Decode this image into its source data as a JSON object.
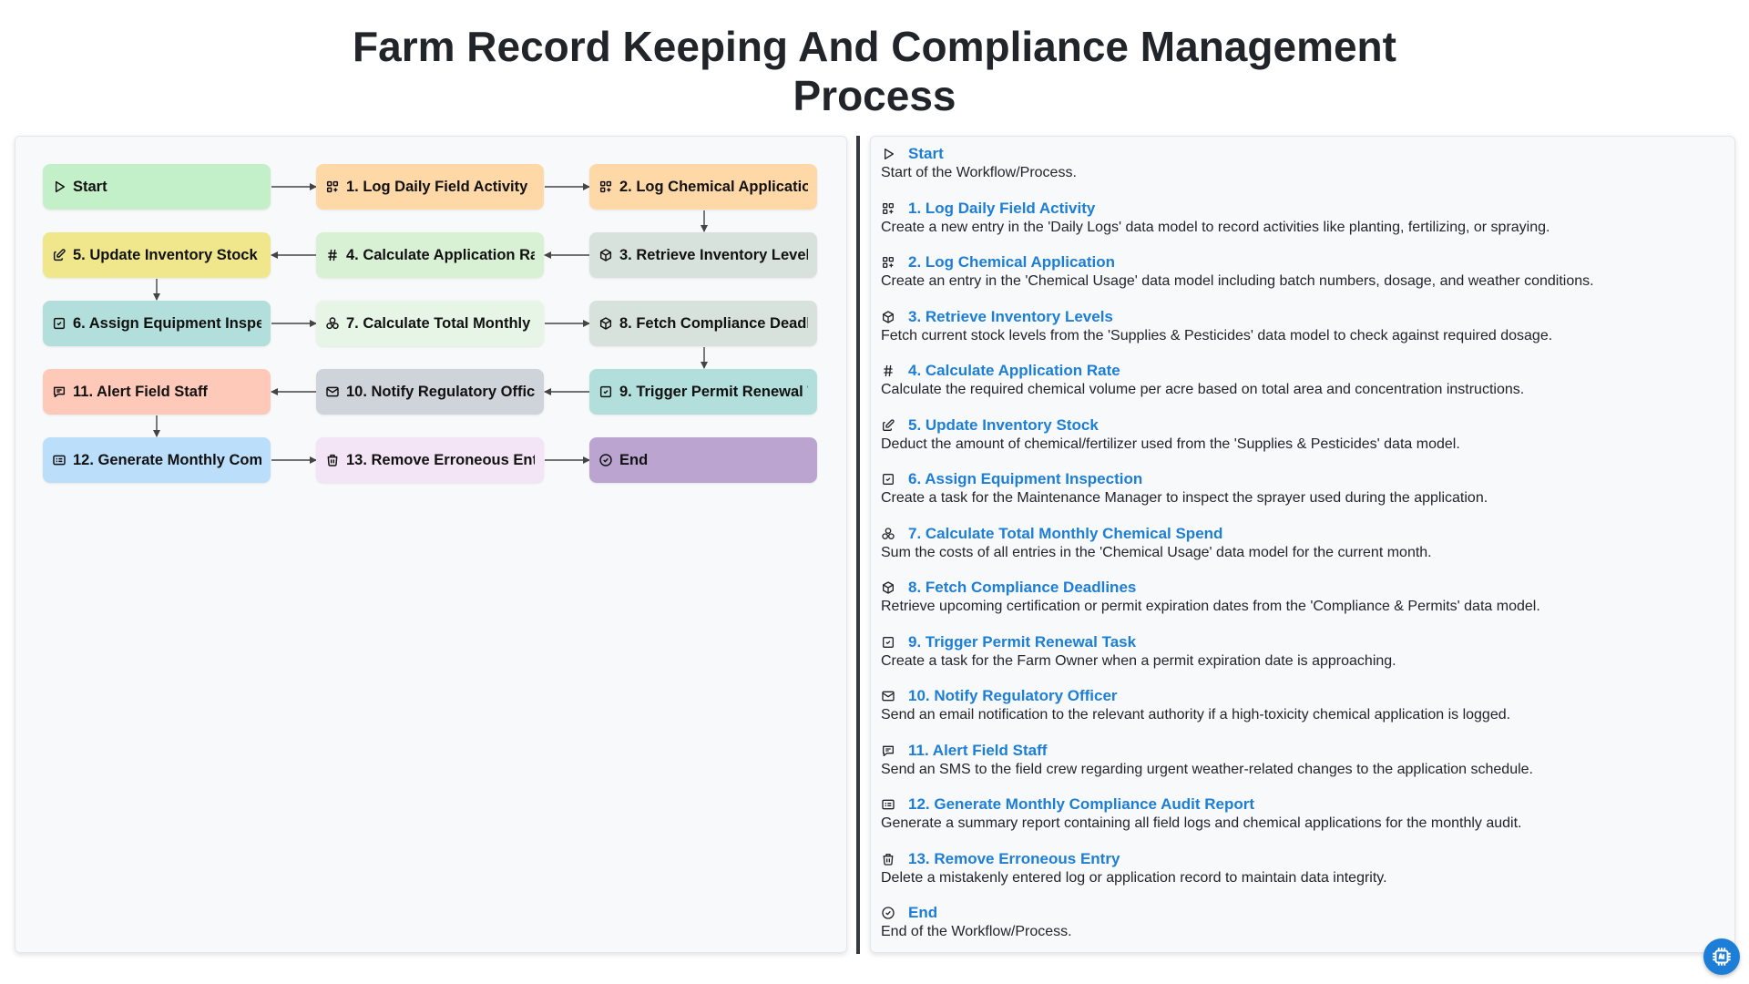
{
  "title_line1": "Farm Record Keeping And Compliance Management",
  "title_line2": "Process",
  "colors": {
    "link": "#1c7ed6",
    "start": "#c3f0c8",
    "log_daily": "#ffd8a8",
    "log_chemical": "#ffd8a8",
    "retrieve_inventory": "#d8e2dc",
    "calc_rate": "#d8f0d4",
    "update_inventory": "#f0e68c",
    "assign_inspection": "#b2dfdb",
    "calc_spend": "#e6f5e6",
    "fetch_deadlines": "#d8e2dc",
    "trigger_permit": "#b2dfdb",
    "notify_officer": "#ced4da",
    "alert_staff": "#ffc9b9",
    "generate_report": "#bbdefb",
    "remove_entry": "#f3e5f5",
    "end": "#bba5d0"
  },
  "flow": {
    "start": {
      "label": "Start",
      "icon": "play-icon"
    },
    "log_daily": {
      "label": "1. Log Daily Field Activity",
      "icon": "apps-plus-icon"
    },
    "log_chemical": {
      "label": "2. Log Chemical Application",
      "icon": "apps-plus-icon"
    },
    "retrieve_inventory": {
      "label": "3. Retrieve Inventory Levels",
      "icon": "box-icon"
    },
    "calc_rate": {
      "label": "4. Calculate Application Rate",
      "icon": "hash-icon"
    },
    "update_inventory": {
      "label": "5. Update Inventory Stock",
      "icon": "edit-icon"
    },
    "assign_inspection": {
      "label": "6. Assign Equipment Inspection",
      "icon": "checkbox-icon"
    },
    "calc_spend": {
      "label": "7. Calculate Total Monthly Chemical Spend",
      "icon": "circles-icon"
    },
    "fetch_deadlines": {
      "label": "8. Fetch Compliance Deadlines",
      "icon": "box-icon"
    },
    "trigger_permit": {
      "label": "9. Trigger Permit Renewal Task",
      "icon": "checkbox-icon"
    },
    "notify_officer": {
      "label": "10. Notify Regulatory Officer",
      "icon": "mail-icon"
    },
    "alert_staff": {
      "label": "11. Alert Field Staff",
      "icon": "message-icon"
    },
    "generate_report": {
      "label": "12. Generate Monthly Compliance Audit Report",
      "icon": "report-icon"
    },
    "remove_entry": {
      "label": "13. Remove Erroneous Entry",
      "icon": "trash-icon"
    },
    "end": {
      "label": "End",
      "icon": "check-circle-icon"
    }
  },
  "steps": [
    {
      "title": "Start",
      "desc": "Start of the Workflow/Process.",
      "icon": "play-icon"
    },
    {
      "title": "1. Log Daily Field Activity",
      "desc": "Create a new entry in the 'Daily Logs' data model to record activities like planting, fertilizing, or spraying.",
      "icon": "apps-plus-icon"
    },
    {
      "title": "2. Log Chemical Application",
      "desc": "Create an entry in the 'Chemical Usage' data model including batch numbers, dosage, and weather conditions.",
      "icon": "apps-plus-icon"
    },
    {
      "title": "3. Retrieve Inventory Levels",
      "desc": "Fetch current stock levels from the 'Supplies & Pesticides' data model to check against required dosage.",
      "icon": "box-icon"
    },
    {
      "title": "4. Calculate Application Rate",
      "desc": "Calculate the required chemical volume per acre based on total area and concentration instructions.",
      "icon": "hash-icon"
    },
    {
      "title": "5. Update Inventory Stock",
      "desc": "Deduct the amount of chemical/fertilizer used from the 'Supplies & Pesticides' data model.",
      "icon": "edit-icon"
    },
    {
      "title": "6. Assign Equipment Inspection",
      "desc": "Create a task for the Maintenance Manager to inspect the sprayer used during the application.",
      "icon": "checkbox-icon"
    },
    {
      "title": "7. Calculate Total Monthly Chemical Spend",
      "desc": "Sum the costs of all entries in the 'Chemical Usage' data model for the current month.",
      "icon": "circles-icon"
    },
    {
      "title": "8. Fetch Compliance Deadlines",
      "desc": "Retrieve upcoming certification or permit expiration dates from the 'Compliance & Permits' data model.",
      "icon": "box-icon"
    },
    {
      "title": "9. Trigger Permit Renewal Task",
      "desc": "Create a task for the Farm Owner when a permit expiration date is approaching.",
      "icon": "checkbox-icon"
    },
    {
      "title": "10. Notify Regulatory Officer",
      "desc": "Send an email notification to the relevant authority if a high-toxicity chemical application is logged.",
      "icon": "mail-icon"
    },
    {
      "title": "11. Alert Field Staff",
      "desc": "Send an SMS to the field crew regarding urgent weather-related changes to the application schedule.",
      "icon": "message-icon"
    },
    {
      "title": "12. Generate Monthly Compliance Audit Report",
      "desc": "Generate a summary report containing all field logs and chemical applications for the monthly audit.",
      "icon": "report-icon"
    },
    {
      "title": "13. Remove Erroneous Entry",
      "desc": "Delete a mistakenly entered log or application record to maintain data integrity.",
      "icon": "trash-icon"
    },
    {
      "title": "End",
      "desc": "End of the Workflow/Process.",
      "icon": "check-circle-icon"
    }
  ],
  "fab_icon": "cpu-icon"
}
